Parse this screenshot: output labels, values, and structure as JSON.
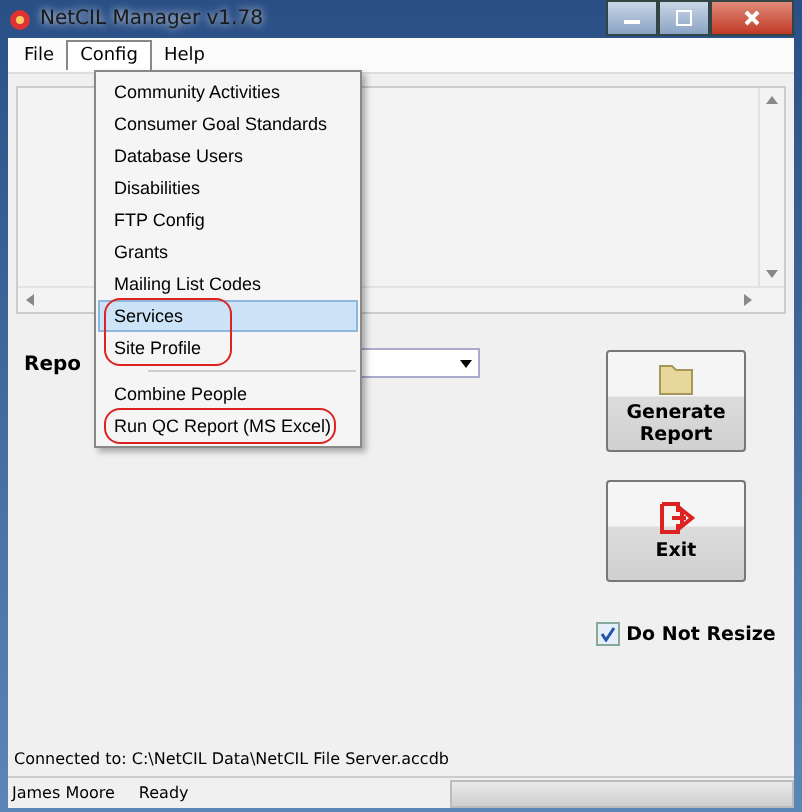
{
  "window": {
    "title": "NetCIL Manager v1.78"
  },
  "menubar": [
    {
      "label": "File",
      "selected": false
    },
    {
      "label": "Config",
      "selected": true
    },
    {
      "label": "Help",
      "selected": false
    }
  ],
  "menu": {
    "groups": [
      {
        "kind": "items",
        "circled": false,
        "items": [
          {
            "label": "Community Activities",
            "selected": false
          },
          {
            "label": "Consumer Goal Standards",
            "selected": false
          },
          {
            "label": "Database Users",
            "selected": false
          },
          {
            "label": "Disabilities",
            "selected": false
          },
          {
            "label": "FTP Config",
            "selected": false
          },
          {
            "label": "Grants",
            "selected": false
          },
          {
            "label": "Mailing List Codes",
            "selected": false
          }
        ]
      },
      {
        "kind": "items",
        "circled": true,
        "items": [
          {
            "label": "Services",
            "selected": true
          },
          {
            "label": "Site Profile",
            "selected": false
          }
        ]
      },
      {
        "kind": "separator"
      },
      {
        "kind": "items",
        "circled": false,
        "items": [
          {
            "label": "Combine People",
            "selected": false
          }
        ]
      },
      {
        "kind": "items",
        "circled": true,
        "items": [
          {
            "label": "Run QC Report (MS Excel)",
            "selected": false
          }
        ]
      }
    ]
  },
  "report_label": "Repo",
  "buttons": [
    {
      "kind": "generate",
      "label": "Generate Report"
    },
    {
      "kind": "exit",
      "label": "Exit"
    }
  ],
  "do_not_resize": {
    "label": "Do Not Resize",
    "checked": true
  },
  "connection": "Connected to: C:\\NetCIL Data\\NetCIL File Server.accdb",
  "status_bar": {
    "user": "James Moore",
    "status": "Ready",
    "progress": {
      "level": 0
    }
  }
}
